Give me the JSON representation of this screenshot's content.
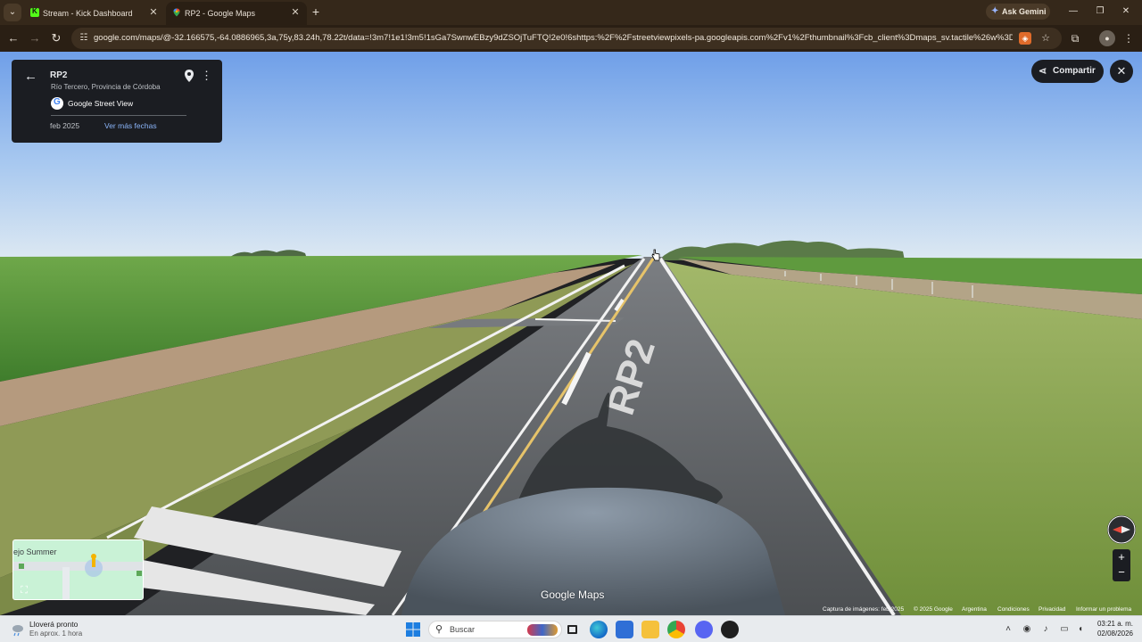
{
  "browser": {
    "tabs": [
      {
        "title": "Stream - Kick Dashboard",
        "active": false
      },
      {
        "title": "RP2 - Google Maps",
        "active": true
      }
    ],
    "gemini_label": "Ask Gemini",
    "url": "google.com/maps/@-32.166575,-64.0886965,3a,75y,83.24h,78.22t/data=!3m7!1e1!3m5!1sGa7SwnwEBzy9dZSOjTuFTQ!2e0!6shttps:%2F%2Fstreetviewpixels-pa.googleapis.com%2Fv1%2Fthumbnail%3Fcb_client%3Dmaps_sv.tactile%26w%3D900%26h..."
  },
  "street_view": {
    "card": {
      "title": "RP2",
      "subtitle": "Río Tercero, Provincia de Córdoba",
      "source": "Google Street View",
      "date": "feb 2025",
      "more_dates": "Ver más fechas"
    },
    "share_label": "Compartir",
    "minimap_label": "ejo Summer",
    "road_marking": "RP2",
    "watermark": "Google Maps",
    "footer": {
      "capture": "Captura de imágenes: feb 2025",
      "copyright": "© 2025 Google",
      "country": "Argentina",
      "terms": "Condiciones",
      "privacy": "Privacidad",
      "report": "Informar un problema"
    }
  },
  "taskbar": {
    "weather_title": "Lloverá pronto",
    "weather_sub": "En aprox. 1 hora",
    "search_placeholder": "Buscar",
    "time": "03:21 a. m.",
    "date": "02/08/2026"
  }
}
